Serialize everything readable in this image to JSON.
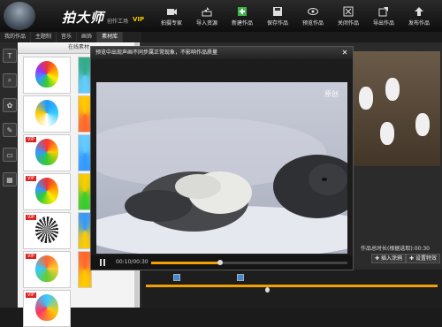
{
  "app": {
    "title": "拍大师",
    "subtitle": "创作工场",
    "badge": "VIP"
  },
  "toolbar": [
    {
      "label": "拍摄专家",
      "icon": "camera-icon"
    },
    {
      "label": "导入资源",
      "icon": "import-icon"
    },
    {
      "label": "新建作品",
      "icon": "new-icon"
    },
    {
      "label": "保存作品",
      "icon": "save-icon"
    },
    {
      "label": "预览作品",
      "icon": "eye-icon"
    },
    {
      "label": "关闭作品",
      "icon": "close-icon"
    },
    {
      "label": "导出作品",
      "icon": "export-icon"
    },
    {
      "label": "发布作品",
      "icon": "upload-icon"
    }
  ],
  "tabs": [
    "我的作品",
    "主题制",
    "音乐",
    "画饰",
    "素材库"
  ],
  "library": {
    "title": "在线素材",
    "vip_label": "VIP"
  },
  "dialog": {
    "title": "预览中出现声画不同步属正常现象，不影响作品质量",
    "watermark": "原创",
    "current_time": "00:10",
    "total_time": "00:30",
    "progress": 0.35
  },
  "right": {
    "duration_label": "作品总时长(根据选取):00:30",
    "insert_label": "插入涂鸦",
    "effect_label": "设置特效"
  },
  "colors": {
    "accent": "#f0a000",
    "marker": "#3a8ad8"
  }
}
